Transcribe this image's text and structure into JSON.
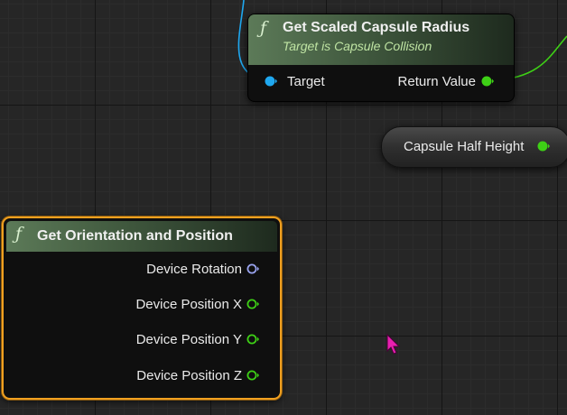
{
  "capsule_node": {
    "icon": "function-icon",
    "title": "Get Scaled Capsule Radius",
    "subtitle": "Target is Capsule Collision",
    "input_pin": "Target",
    "output_pin": "Return Value"
  },
  "half_height_node": {
    "label": "Capsule Half Height"
  },
  "orientation_node": {
    "icon": "function-icon",
    "title": "Get Orientation and Position",
    "pins": [
      "Device Rotation",
      "Device Position X",
      "Device Position Y",
      "Device Position Z"
    ]
  },
  "colors": {
    "object_pin": "#1fa8f0",
    "float_pin": "#3ed016",
    "rotator_pin": "#9aa4f0",
    "selection_outline": "#f0a020",
    "cursor": "#e820b0"
  }
}
